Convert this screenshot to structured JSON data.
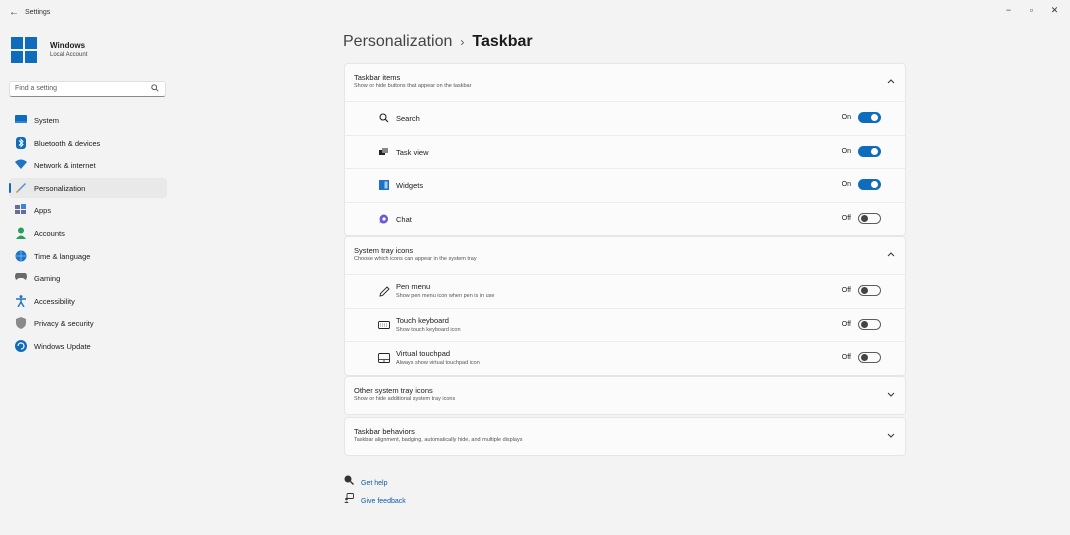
{
  "window": {
    "title": "Settings",
    "back_glyph": "←",
    "controls": {
      "minimize": "−",
      "maximize": "▫",
      "close": "✕"
    }
  },
  "account": {
    "name": "Windows",
    "type": "Local Account"
  },
  "search": {
    "placeholder": "Find a setting",
    "icon": "search-icon"
  },
  "nav": [
    {
      "label": "System",
      "icon": "system-icon",
      "color": "#0f6cbd"
    },
    {
      "label": "Bluetooth & devices",
      "icon": "bluetooth-icon",
      "color": "#0f6cbd"
    },
    {
      "label": "Network & internet",
      "icon": "wifi-icon",
      "color": "#1e72c8"
    },
    {
      "label": "Personalization",
      "icon": "brush-icon",
      "color": "#d67a2a",
      "active": true
    },
    {
      "label": "Apps",
      "icon": "apps-icon",
      "color": "#5a5a8a"
    },
    {
      "label": "Accounts",
      "icon": "person-icon",
      "color": "#2a9d5c"
    },
    {
      "label": "Time & language",
      "icon": "globe-clock-icon",
      "color": "#1e72c8"
    },
    {
      "label": "Gaming",
      "icon": "gamepad-icon",
      "color": "#666666"
    },
    {
      "label": "Accessibility",
      "icon": "accessibility-icon",
      "color": "#1e72c8"
    },
    {
      "label": "Privacy & security",
      "icon": "shield-icon",
      "color": "#888888"
    },
    {
      "label": "Windows Update",
      "icon": "update-icon",
      "color": "#0f6cbd"
    }
  ],
  "breadcrumb": {
    "parent": "Personalization",
    "separator": "›",
    "current": "Taskbar"
  },
  "sections": {
    "taskbar_items": {
      "title": "Taskbar items",
      "subtitle": "Show or hide buttons that appear on the taskbar",
      "chevron": "^",
      "rows": [
        {
          "label": "Search",
          "state": "On",
          "icon": "search-icon"
        },
        {
          "label": "Task view",
          "state": "On",
          "icon": "task-view-icon"
        },
        {
          "label": "Widgets",
          "state": "On",
          "icon": "widgets-icon"
        },
        {
          "label": "Chat",
          "state": "Off",
          "icon": "chat-icon"
        }
      ]
    },
    "system_tray": {
      "title": "System tray icons",
      "subtitle": "Choose which icons can appear in the system tray",
      "chevron": "^",
      "rows": [
        {
          "label": "Pen menu",
          "sub": "Show pen menu icon when pen is in use",
          "state": "Off",
          "icon": "pen-icon"
        },
        {
          "label": "Touch keyboard",
          "sub": "Show touch keyboard icon",
          "state": "Off",
          "icon": "keyboard-icon"
        },
        {
          "label": "Virtual touchpad",
          "sub": "Always show virtual touchpad icon",
          "state": "Off",
          "icon": "touchpad-icon"
        }
      ]
    },
    "other_tray": {
      "title": "Other system tray icons",
      "subtitle": "Show or hide additional system tray icons",
      "chevron": "v"
    },
    "behaviors": {
      "title": "Taskbar behaviors",
      "subtitle": "Taskbar alignment, badging, automatically hide, and multiple displays",
      "chevron": "v"
    }
  },
  "links": {
    "help": "Get help",
    "feedback": "Give feedback"
  },
  "colors": {
    "accent": "#0f6cbd",
    "background": "#f3f3f3",
    "card": "#fbfbfb"
  }
}
